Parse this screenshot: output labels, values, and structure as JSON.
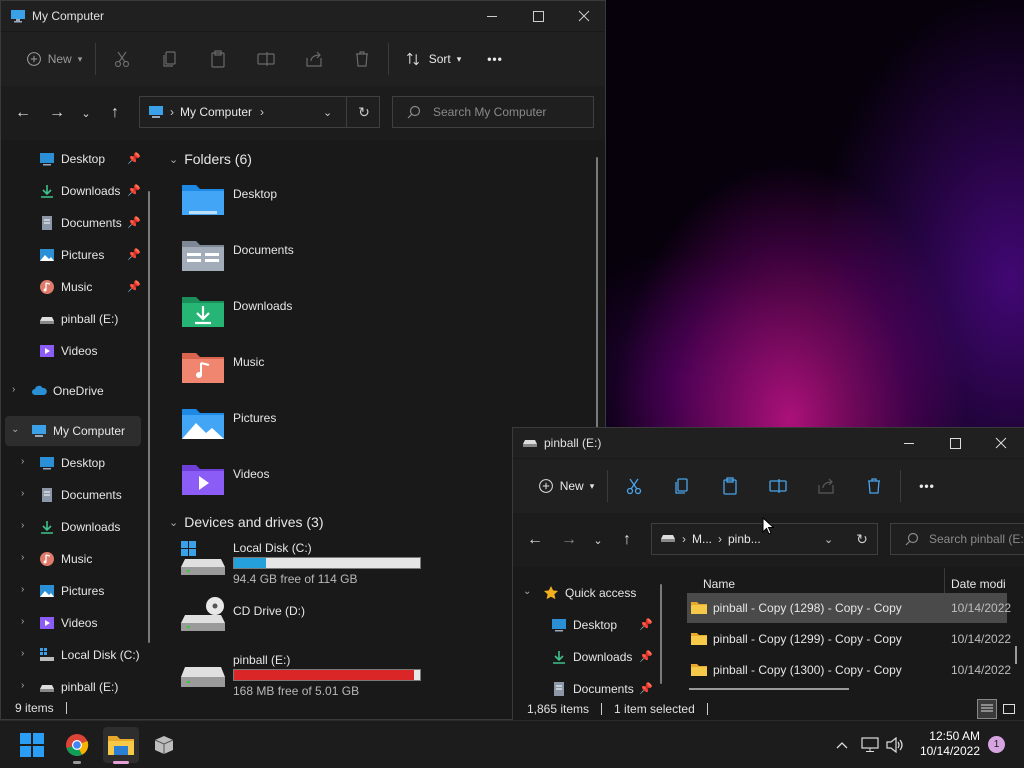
{
  "window1": {
    "title": "My Computer",
    "toolbar": {
      "new_label": "New",
      "sort_label": "Sort",
      "more_label": "•••"
    },
    "address": {
      "location": "My Computer",
      "separator": "›"
    },
    "search": {
      "placeholder": "Search My Computer"
    },
    "sidebar": {
      "pinned": [
        {
          "label": "Desktop",
          "icon": "desktop-icon"
        },
        {
          "label": "Downloads",
          "icon": "downloads-icon"
        },
        {
          "label": "Documents",
          "icon": "documents-icon"
        },
        {
          "label": "Pictures",
          "icon": "pictures-icon"
        },
        {
          "label": "Music",
          "icon": "music-icon"
        },
        {
          "label": "pinball (E:)",
          "icon": "drive-icon"
        },
        {
          "label": "Videos",
          "icon": "videos-icon"
        }
      ],
      "onedrive": "OneDrive",
      "mycomputer": "My Computer",
      "children": [
        {
          "label": "Desktop"
        },
        {
          "label": "Documents"
        },
        {
          "label": "Downloads"
        },
        {
          "label": "Music"
        },
        {
          "label": "Pictures"
        },
        {
          "label": "Videos"
        },
        {
          "label": "Local Disk (C:)"
        },
        {
          "label": "pinball (E:)"
        }
      ]
    },
    "folders_heading": "Folders (6)",
    "folders": [
      {
        "label": "Desktop"
      },
      {
        "label": "Documents"
      },
      {
        "label": "Downloads"
      },
      {
        "label": "Music"
      },
      {
        "label": "Pictures"
      },
      {
        "label": "Videos"
      }
    ],
    "devices_heading": "Devices and drives (3)",
    "drives": [
      {
        "label": "Local Disk (C:)",
        "free": "94.4 GB free of 114 GB",
        "used_fraction": 0.17,
        "fill_color": "#26a0da"
      },
      {
        "label": "CD Drive (D:)"
      },
      {
        "label": "pinball (E:)",
        "free": "168 MB free of 5.01 GB",
        "used_fraction": 0.967,
        "fill_color": "#da2626"
      }
    ],
    "status": {
      "items": "9 items"
    }
  },
  "window2": {
    "title": "pinball (E:)",
    "toolbar": {
      "new_label": "New",
      "more_label": "•••"
    },
    "address": {
      "seg1": "M...",
      "seg2": "pinb..."
    },
    "search": {
      "placeholder": "Search pinball (E:)"
    },
    "sidebar": {
      "quick_access": "Quick access",
      "items": [
        {
          "label": "Desktop"
        },
        {
          "label": "Downloads"
        },
        {
          "label": "Documents"
        }
      ]
    },
    "columns": {
      "name": "Name",
      "date": "Date modi"
    },
    "files": [
      {
        "name": "pinball - Copy (1298) - Copy - Copy",
        "date": "10/14/2022",
        "selected": true
      },
      {
        "name": "pinball - Copy (1299) - Copy - Copy",
        "date": "10/14/2022",
        "selected": false
      },
      {
        "name": "pinball - Copy (1300) - Copy - Copy",
        "date": "10/14/2022",
        "selected": false
      }
    ],
    "status": {
      "items": "1,865 items",
      "selected": "1 item selected"
    }
  },
  "taskbar": {
    "time": "12:50 AM",
    "date": "10/14/2022",
    "notification_count": "1"
  },
  "colors": {
    "accent": "#0078d4",
    "selection": "#4a4a4a"
  }
}
